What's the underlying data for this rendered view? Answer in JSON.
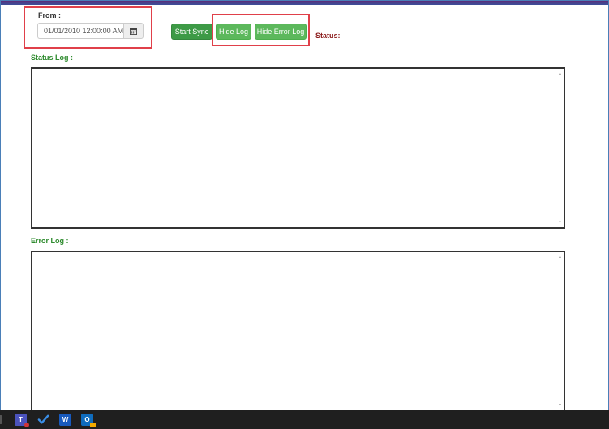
{
  "colors": {
    "accent_bar": "#5a2d7a",
    "start_button": "#3d9a46",
    "hide_button": "#5cb85c",
    "section_label": "#2e8b2e",
    "status_label": "#8b1a1a",
    "highlight": "#e0404a"
  },
  "filter": {
    "from_label": "From :",
    "date_value": "01/01/2010 12:00:00 AM",
    "calendar_icon": "calendar-icon"
  },
  "toolbar": {
    "start_sync": "Start Sync",
    "hide_log": "Hide Log",
    "hide_error_log": "Hide Error Log",
    "status_label": "Status:"
  },
  "status_log": {
    "label": "Status Log :",
    "content": ""
  },
  "error_log": {
    "label": "Error Log :",
    "content": ""
  },
  "taskbar": {
    "icons": [
      "teams-icon",
      "todo-check-icon",
      "word-icon",
      "outlook-icon"
    ]
  }
}
